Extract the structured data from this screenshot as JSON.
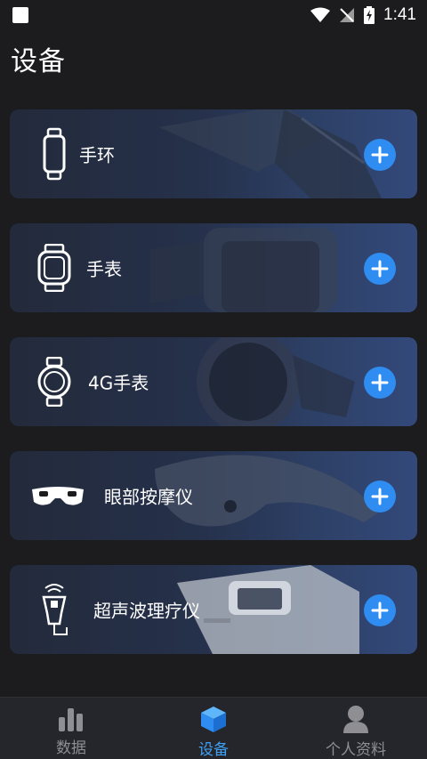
{
  "status_bar": {
    "time": "1:41"
  },
  "page": {
    "title": "设备"
  },
  "devices": [
    {
      "label": "手环",
      "icon": "band-icon"
    },
    {
      "label": "手表",
      "icon": "square-watch-icon"
    },
    {
      "label": "4G手表",
      "icon": "round-watch-icon"
    },
    {
      "label": "眼部按摩仪",
      "icon": "eye-massager-icon"
    },
    {
      "label": "超声波理疗仪",
      "icon": "ultrasound-device-icon"
    }
  ],
  "nav": {
    "items": [
      {
        "label": "数据",
        "icon": "bar-chart-icon",
        "active": false
      },
      {
        "label": "设备",
        "icon": "cube-icon",
        "active": true
      },
      {
        "label": "个人资料",
        "icon": "person-icon",
        "active": false
      }
    ]
  },
  "colors": {
    "accent": "#2f8cf0",
    "active_nav": "#3ea0f5",
    "background": "#1c1c1e"
  }
}
